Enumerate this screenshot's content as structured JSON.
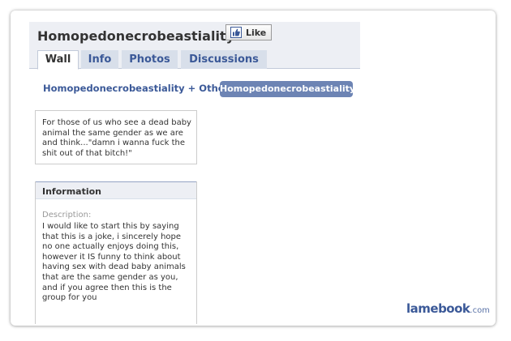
{
  "group": {
    "name": "Homopedonecrobeastiality"
  },
  "like_button": {
    "label": "Like",
    "icon": "thumbs-up-icon"
  },
  "tabs": [
    {
      "label": "Wall",
      "active": true
    },
    {
      "label": "Info",
      "active": false
    },
    {
      "label": "Photos",
      "active": false
    },
    {
      "label": "Discussions",
      "active": false
    }
  ],
  "wall_filter": {
    "others_label": "Homopedonecrobeastiality + Others",
    "selected_label": "Homopedonecrobeastiality"
  },
  "description_box": {
    "text": "For those of us who see a dead baby animal the same gender as we are and think...\"damn i wanna fuck the shit out of that bitch!\""
  },
  "information": {
    "header": "Information",
    "description_label": "Description:",
    "description_text": "I would like to start this by saying that this is a joke, i sincerely hope no one actually enjoys doing this, however it IS funny to think about having sex with dead baby animals that are the same gender as you, and if you agree then this is the group for you"
  },
  "watermark": {
    "brand": "lamebook",
    "suffix": ".com"
  },
  "colors": {
    "link_blue": "#3b5998",
    "header_bg": "#edeff4",
    "tab_bg": "#d8dfea",
    "pill_bg": "#6d84b4"
  }
}
